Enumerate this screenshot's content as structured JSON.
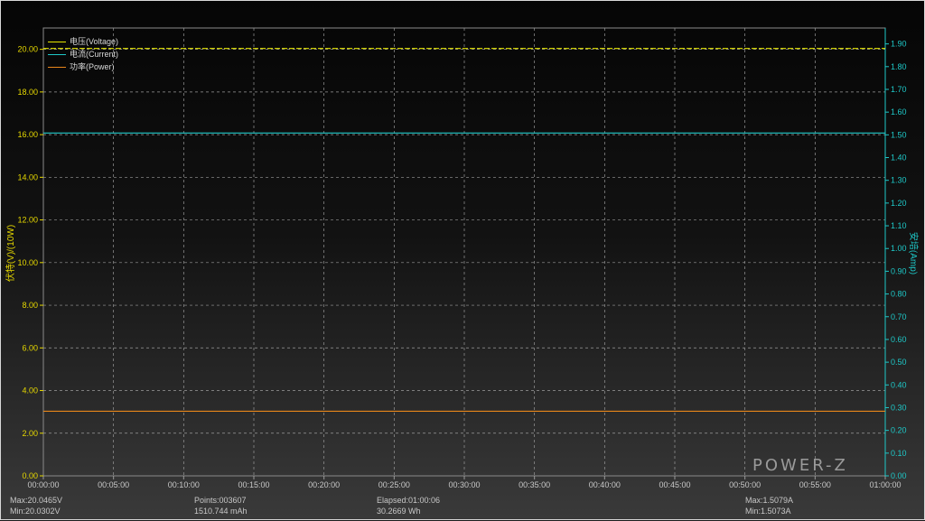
{
  "chart_data": {
    "type": "line",
    "x_ticks": [
      "00:00:00",
      "00:05:00",
      "00:10:00",
      "00:15:00",
      "00:20:00",
      "00:25:00",
      "00:30:00",
      "00:35:00",
      "00:40:00",
      "00:45:00",
      "00:50:00",
      "00:55:00",
      "01:00:00"
    ],
    "xlim_seconds": [
      0,
      3600
    ],
    "y_left": {
      "label": "伏特(V)/(10W)",
      "lim": [
        0,
        21.0
      ],
      "ticks": [
        "0.00",
        "2.00",
        "4.00",
        "6.00",
        "8.00",
        "10.00",
        "12.00",
        "14.00",
        "16.00",
        "18.00",
        "20.00"
      ],
      "color": "#e6d800"
    },
    "y_right": {
      "label": "安培(Amp)",
      "lim": [
        0,
        1.97
      ],
      "ticks": [
        "0.00",
        "0.10",
        "0.20",
        "0.30",
        "0.40",
        "0.50",
        "0.60",
        "0.70",
        "0.80",
        "0.90",
        "1.00",
        "1.10",
        "1.20",
        "1.30",
        "1.40",
        "1.50",
        "1.60",
        "1.70",
        "1.80",
        "1.90"
      ],
      "color": "#1ec8c8"
    },
    "series": [
      {
        "name": "电压(Voltage)",
        "axis": "left",
        "color": "#e6e600",
        "dashed": true,
        "x": [
          0,
          3600
        ],
        "y": [
          20.04,
          20.04
        ]
      },
      {
        "name": "电流(Current)",
        "axis": "right",
        "color": "#1ec8c8",
        "x": [
          0,
          3600
        ],
        "y": [
          1.508,
          1.508
        ]
      },
      {
        "name": "功率(Power)",
        "axis": "left",
        "color": "#e8861a",
        "x": [
          0,
          3600
        ],
        "y": [
          3.03,
          3.03
        ]
      }
    ],
    "grid": true,
    "legend_position": "top-left"
  },
  "stats": {
    "voltage_max": "Max:20.0465V",
    "voltage_min": "Min:20.0302V",
    "points": "Points:003607",
    "capacity": "1510.744 mAh",
    "elapsed": "Elapsed:01:00:06",
    "energy": "30.2669 Wh",
    "current_max": "Max:1.5079A",
    "current_min": "Min:1.5073A"
  },
  "logo": "POWER-Z"
}
